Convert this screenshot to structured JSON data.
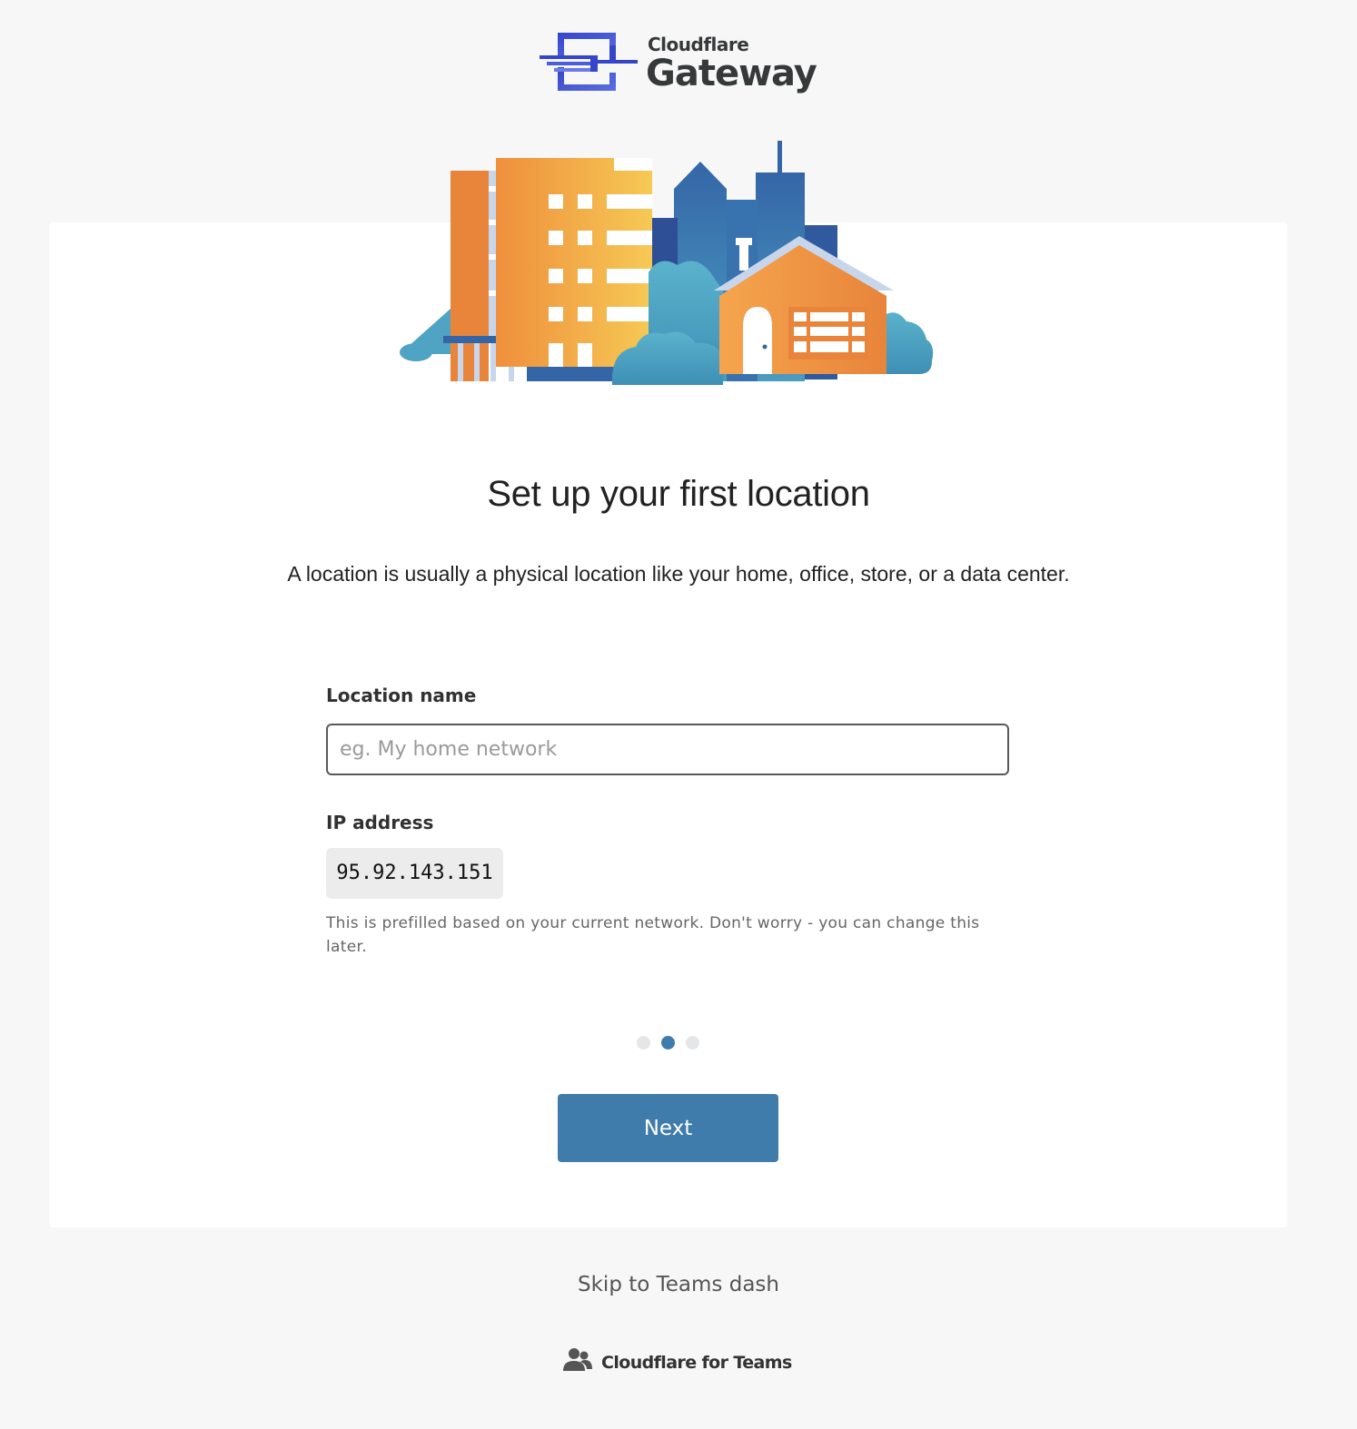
{
  "header": {
    "brand_small": "Cloudflare",
    "brand_product": "Gateway",
    "logo_icon": "gateway-logo-icon"
  },
  "illustration": {
    "icon": "city-buildings-illustration"
  },
  "main": {
    "title": "Set up your first location",
    "subtitle": "A location is usually a physical location like your home, office, store, or a data center."
  },
  "form": {
    "location_label": "Location name",
    "location_placeholder": "eg. My home network",
    "location_value": "",
    "ip_label": "IP address",
    "ip_value": "95.92.143.151",
    "ip_helper": "This is prefilled based on your current network. Don't worry - you can change this later."
  },
  "stepper": {
    "total_steps": 3,
    "current_step": 2
  },
  "actions": {
    "next_label": "Next",
    "skip_label": "Skip to Teams dash"
  },
  "footer": {
    "label": "Cloudflare for Teams",
    "icon": "people-icon"
  },
  "colors": {
    "page_background": "#f7f7f7",
    "card_background": "#ffffff",
    "primary_button": "#407cab",
    "active_dot": "#3f7bac",
    "inactive_dot": "#e4e6e8",
    "logo_blue": "#3f4fd1"
  }
}
